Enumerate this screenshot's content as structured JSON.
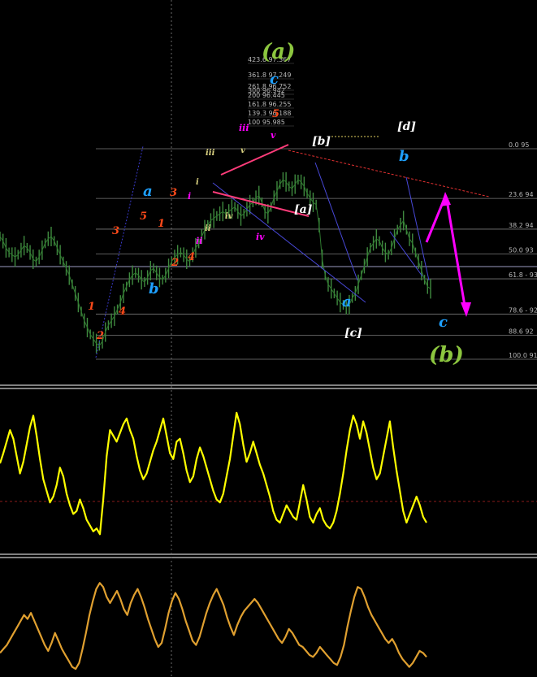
{
  "chart_data": {
    "type": "line",
    "panels": [
      {
        "name": "price",
        "series": [
          {
            "values": [
              0.55,
              0.53,
              0.5,
              0.48,
              0.47,
              0.46,
              0.47,
              0.49,
              0.51,
              0.5,
              0.48,
              0.45,
              0.44,
              0.46,
              0.49,
              0.52,
              0.54,
              0.55,
              0.53,
              0.5,
              0.47,
              0.44,
              0.41,
              0.38,
              0.34,
              0.3,
              0.26,
              0.22,
              0.18,
              0.15,
              0.12,
              0.1,
              0.08,
              0.07,
              0.09,
              0.13,
              0.16,
              0.18,
              0.2,
              0.23,
              0.26,
              0.3,
              0.33,
              0.36,
              0.38,
              0.39,
              0.38,
              0.36,
              0.35,
              0.37,
              0.4,
              0.41,
              0.39,
              0.37,
              0.36,
              0.38,
              0.41,
              0.44,
              0.46,
              0.47,
              0.48,
              0.47,
              0.45,
              0.44,
              0.47,
              0.5,
              0.52,
              0.55,
              0.58,
              0.6,
              0.62,
              0.63,
              0.64,
              0.65,
              0.66,
              0.65,
              0.66,
              0.67,
              0.68,
              0.66,
              0.64,
              0.65,
              0.67,
              0.69,
              0.7,
              0.72,
              0.73,
              0.7,
              0.66,
              0.65,
              0.68,
              0.72,
              0.75,
              0.78,
              0.8,
              0.79,
              0.77,
              0.76,
              0.78,
              0.8,
              0.79,
              0.77,
              0.74,
              0.72,
              0.7,
              0.69,
              0.6,
              0.45,
              0.38,
              0.34,
              0.32,
              0.3,
              0.28,
              0.26,
              0.25,
              0.24,
              0.25,
              0.28,
              0.3,
              0.34,
              0.38,
              0.42,
              0.46,
              0.5,
              0.52,
              0.54,
              0.53,
              0.5,
              0.48,
              0.47,
              0.5,
              0.54,
              0.58,
              0.6,
              0.62,
              0.58,
              0.54,
              0.52,
              0.48,
              0.44,
              0.4,
              0.36,
              0.33,
              0.32
            ]
          }
        ],
        "levels": [
          {
            "label": "0.0 95",
            "value": 0.0
          },
          {
            "label": "23.6 94",
            "value": 23.6
          },
          {
            "label": "38.2 94",
            "value": 38.2
          },
          {
            "label": "50.0 93",
            "value": 50.0
          },
          {
            "label": "61.8 - 93",
            "value": 61.8
          },
          {
            "label": "78.6 - 92",
            "value": 78.6
          },
          {
            "label": "88.6 92",
            "value": 88.6
          },
          {
            "label": "100.0 91",
            "value": 100.0
          }
        ]
      },
      {
        "name": "oscillator-yellow",
        "series": [
          {
            "values": [
              0.55,
              0.62,
              0.7,
              0.78,
              0.72,
              0.6,
              0.48,
              0.56,
              0.68,
              0.8,
              0.88,
              0.74,
              0.58,
              0.44,
              0.36,
              0.28,
              0.32,
              0.4,
              0.52,
              0.46,
              0.34,
              0.26,
              0.2,
              0.22,
              0.3,
              0.24,
              0.16,
              0.12,
              0.08,
              0.1,
              0.06,
              0.3,
              0.6,
              0.78,
              0.74,
              0.7,
              0.76,
              0.82,
              0.86,
              0.78,
              0.72,
              0.6,
              0.5,
              0.44,
              0.48,
              0.56,
              0.64,
              0.7,
              0.78,
              0.86,
              0.74,
              0.62,
              0.58,
              0.7,
              0.72,
              0.62,
              0.5,
              0.42,
              0.46,
              0.58,
              0.66,
              0.6,
              0.52,
              0.44,
              0.36,
              0.3,
              0.28,
              0.34,
              0.46,
              0.58,
              0.74,
              0.9,
              0.82,
              0.68,
              0.56,
              0.62,
              0.7,
              0.62,
              0.54,
              0.48,
              0.4,
              0.32,
              0.22,
              0.16,
              0.14,
              0.2,
              0.26,
              0.22,
              0.18,
              0.16,
              0.28,
              0.4,
              0.3,
              0.18,
              0.14,
              0.2,
              0.24,
              0.16,
              0.12,
              0.1,
              0.14,
              0.22,
              0.34,
              0.48,
              0.64,
              0.78,
              0.88,
              0.82,
              0.72,
              0.84,
              0.76,
              0.64,
              0.52,
              0.44,
              0.48,
              0.6,
              0.72,
              0.84,
              0.66,
              0.5,
              0.36,
              0.22,
              0.14,
              0.2,
              0.26,
              0.32,
              0.26,
              0.18,
              0.14
            ]
          }
        ]
      },
      {
        "name": "oscillator-orange",
        "series": [
          {
            "values": [
              0.2,
              0.24,
              0.28,
              0.34,
              0.4,
              0.46,
              0.52,
              0.58,
              0.54,
              0.6,
              0.52,
              0.44,
              0.36,
              0.28,
              0.22,
              0.3,
              0.4,
              0.32,
              0.24,
              0.18,
              0.12,
              0.06,
              0.04,
              0.1,
              0.24,
              0.4,
              0.58,
              0.72,
              0.84,
              0.9,
              0.86,
              0.76,
              0.7,
              0.76,
              0.82,
              0.74,
              0.64,
              0.58,
              0.7,
              0.78,
              0.84,
              0.76,
              0.66,
              0.54,
              0.44,
              0.34,
              0.26,
              0.3,
              0.44,
              0.6,
              0.72,
              0.8,
              0.74,
              0.64,
              0.52,
              0.42,
              0.32,
              0.28,
              0.36,
              0.48,
              0.6,
              0.7,
              0.78,
              0.84,
              0.76,
              0.68,
              0.56,
              0.46,
              0.38,
              0.48,
              0.56,
              0.62,
              0.66,
              0.7,
              0.74,
              0.7,
              0.64,
              0.58,
              0.52,
              0.46,
              0.4,
              0.34,
              0.3,
              0.36,
              0.44,
              0.4,
              0.34,
              0.28,
              0.26,
              0.22,
              0.18,
              0.16,
              0.2,
              0.26,
              0.22,
              0.18,
              0.14,
              0.1,
              0.08,
              0.16,
              0.28,
              0.46,
              0.62,
              0.76,
              0.86,
              0.84,
              0.76,
              0.66,
              0.58,
              0.52,
              0.46,
              0.4,
              0.34,
              0.3,
              0.34,
              0.28,
              0.2,
              0.14,
              0.1,
              0.06,
              0.1,
              0.16,
              0.22,
              0.2,
              0.16
            ]
          }
        ]
      }
    ],
    "wave_labels": [
      {
        "text": "(a)",
        "color": "#8cc63f"
      },
      {
        "text": "(b)",
        "color": "#8cc63f"
      },
      {
        "text": "[a]",
        "color": "#ffffff"
      },
      {
        "text": "[b]",
        "color": "#ffffff"
      },
      {
        "text": "[c]",
        "color": "#ffffff"
      },
      {
        "text": "[d]",
        "color": "#ffffff"
      },
      {
        "text": "a",
        "color": "#1ea0ff"
      },
      {
        "text": "b",
        "color": "#1ea0ff"
      },
      {
        "text": "c",
        "color": "#1ea0ff"
      },
      {
        "text": "a",
        "color": "#1ea0ff"
      },
      {
        "text": "b",
        "color": "#1ea0ff"
      },
      {
        "text": "c",
        "color": "#1ea0ff"
      },
      {
        "text": "b",
        "color": "#1ea0ff"
      },
      {
        "text": "1",
        "color": "#ff4a1a"
      },
      {
        "text": "2",
        "color": "#ff4a1a"
      },
      {
        "text": "3",
        "color": "#ff4a1a"
      },
      {
        "text": "4",
        "color": "#ff4a1a"
      },
      {
        "text": "5",
        "color": "#ff4a1a"
      },
      {
        "text": "1",
        "color": "#ff4a1a"
      },
      {
        "text": "2",
        "color": "#ff4a1a"
      },
      {
        "text": "3",
        "color": "#ff4a1a"
      },
      {
        "text": "4",
        "color": "#ff4a1a"
      },
      {
        "text": "5",
        "color": "#ff4a1a"
      },
      {
        "text": "i",
        "color": "#ff00ff"
      },
      {
        "text": "ii",
        "color": "#ff00ff"
      },
      {
        "text": "iii",
        "color": "#ff00ff"
      },
      {
        "text": "iv",
        "color": "#ff00ff"
      },
      {
        "text": "v",
        "color": "#ff00ff"
      },
      {
        "text": "i",
        "color": "#d8d080"
      },
      {
        "text": "ii",
        "color": "#d8d080"
      },
      {
        "text": "iii",
        "color": "#d8d080"
      },
      {
        "text": "iv",
        "color": "#d8d080"
      },
      {
        "text": "v",
        "color": "#d8d080"
      }
    ],
    "fib_extension_labels": [
      "423.6 97.367",
      "361.8 97.249",
      "300 96.942",
      "261.8 96.752",
      "200 96.445",
      "161.8 96.255",
      "139.3 96.188",
      "100 95.985"
    ],
    "colors": {
      "price": "#3f8a3f",
      "osc1": "#ffff00",
      "osc2": "#e0a030",
      "arrow": "#ff00ff",
      "level": "#7a7a7a",
      "trendline": "#3a3acc",
      "wedge": "#ff3c7a"
    }
  }
}
